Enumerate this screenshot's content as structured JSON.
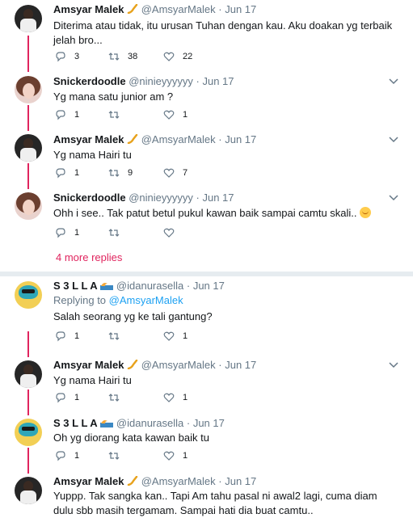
{
  "colors": {
    "accent": "#e0245e",
    "link": "#1da1f2",
    "muted": "#657786",
    "divider": "#e6ecf0"
  },
  "sep": "·",
  "tweets": [
    {
      "name": "Amsyar Malek",
      "handle": "@AmsyarMalek",
      "date": "Jun 17",
      "verified_emoji": "saxophone",
      "text": "Diterima atau tidak, itu urusan Tuhan dengan kau. Aku doakan yg terbaik jelah bro...",
      "replies": "3",
      "retweets": "38",
      "likes": "22"
    },
    {
      "name": "Snickerdoodle",
      "handle": "@ninieyyyyyy",
      "date": "Jun 17",
      "text": "Yg mana satu junior am ?",
      "replies": "1",
      "retweets": "",
      "likes": "1"
    },
    {
      "name": "Amsyar Malek",
      "handle": "@AmsyarMalek",
      "date": "Jun 17",
      "verified_emoji": "saxophone",
      "text": "Yg nama Hairi tu",
      "replies": "1",
      "retweets": "9",
      "likes": "7"
    },
    {
      "name": "Snickerdoodle",
      "handle": "@ninieyyyyyy",
      "date": "Jun 17",
      "text": "Ohh i see.. Tak patut betul pukul kawan baik sampai camtu skali..",
      "replies": "1",
      "retweets": "",
      "likes": ""
    },
    {
      "name": "S 3 L L A",
      "handle": "@idanurasella",
      "date": "Jun 17",
      "emoji": "wave",
      "replying_prefix": "Replying to",
      "replying_to": "@AmsyarMalek",
      "text": "Salah seorang yg ke tali gantung?",
      "replies": "1",
      "retweets": "",
      "likes": "1"
    },
    {
      "name": "Amsyar Malek",
      "handle": "@AmsyarMalek",
      "date": "Jun 17",
      "verified_emoji": "saxophone",
      "text": "Yg nama Hairi tu",
      "replies": "1",
      "retweets": "",
      "likes": "1"
    },
    {
      "name": "S 3 L L A",
      "handle": "@idanurasella",
      "date": "Jun 17",
      "emoji": "wave",
      "text": "Oh yg diorang kata kawan baik tu",
      "replies": "1",
      "retweets": "",
      "likes": "1"
    },
    {
      "name": "Amsyar Malek",
      "handle": "@AmsyarMalek",
      "date": "Jun 17",
      "verified_emoji": "saxophone",
      "text": "Yuppp. Tak sangka kan.. Tapi Am tahu pasal ni awal2 lagi, cuma diam dulu sbb masih tergamam. Sampai hati dia buat camtu.."
    }
  ],
  "more_replies": "4 more replies"
}
